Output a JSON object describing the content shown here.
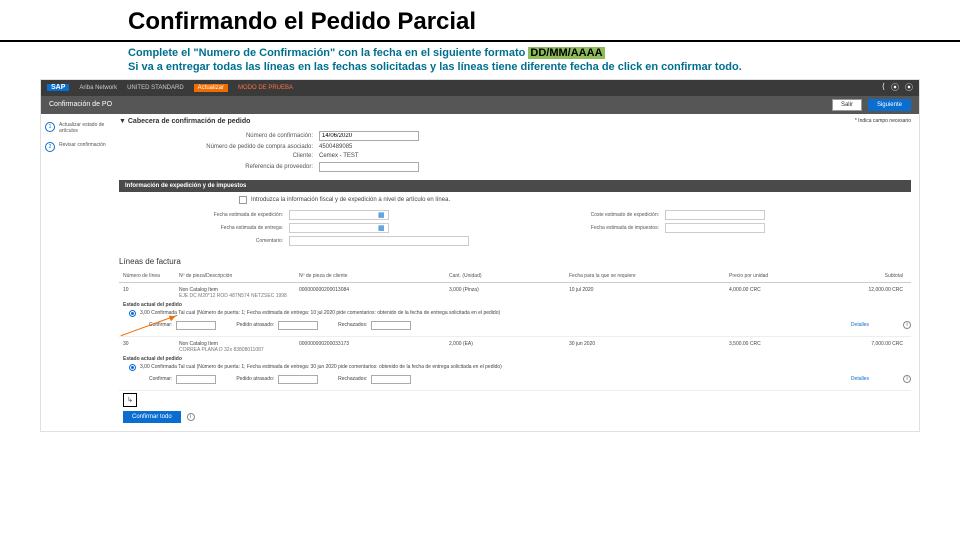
{
  "slide": {
    "title": "Confirmando el Pedido Parcial",
    "instr1_a": "Complete el \"Numero de Confirmación\" con la fecha en el siguiente formato ",
    "instr1_hl": "DD/MM/AAAA",
    "instr2": "Si va a entregar todas las líneas en las fechas solicitadas y las líneas tiene diferente fecha de click en confirmar todo."
  },
  "topbar": {
    "sap": "SAP",
    "network": "Ariba Network",
    "supplier": "UNITED STANDARD",
    "actualizar": "Actualizar",
    "modo": "MODO DE PRUEBA"
  },
  "subbar": {
    "title": "Confirmación de PO",
    "salir": "Salir",
    "siguiente": "Siguiente"
  },
  "steps": {
    "s1": "Actualizar estado de artículos",
    "s2": "Revisar confirmación"
  },
  "header": {
    "panel": "Cabecera de confirmación de pedido",
    "req": "* Indica campo necesario",
    "f1": "Número de confirmación:",
    "f1v": "14/06/2020",
    "f2": "Número de pedido de compra asociado:",
    "f2v": "4500489085",
    "f3": "Cliente:",
    "f3v": "Cemex - TEST",
    "f4": "Referencia de proveedor:"
  },
  "ship": {
    "section": "Información de expedición y de impuestos",
    "cbx_label": "Introduzca la información fiscal y de expedición a nivel de artículo en línea.",
    "r1": "Fecha estimada de expedición:",
    "r2": "Fecha estimada de entrega:",
    "r3": "Comentario:",
    "r4": "Coste estimado de expedición:",
    "r5": "Fecha estimada de impuestos:"
  },
  "lines": {
    "head": "Líneas de factura",
    "h1": "Número de línea",
    "h2": "Nº de pieza/Descripción",
    "h3": "Nº de pieza de cliente",
    "h4": "Cant. (Unidad)",
    "h5": "Fecha para la que se requiere",
    "h6": "Precio por unidad",
    "h7": "Subtotal",
    "status_head": "Estado actual del pedido",
    "confirm": "Confirmar:",
    "ordered": "Pedido atrasado:",
    "rejected": "Rechazados:",
    "details": "Detalles",
    "confirm_all": "Confirmar todo"
  },
  "item1": {
    "num": "10",
    "desc": "Non Catalog Item",
    "meta": "EJE DC M20*12 ROD 487N574 NETZSEC 1998",
    "part": "000000000200013084",
    "qty": "3,000 (Pinza)",
    "date": "10 jul 2020",
    "price": "4,000.00 CRC",
    "subtotal": "12,000.00 CRC",
    "status": "3,00 Confirmada Tal cual (Número de puerta: 1; Fecha estimada de entrega: 10 jul 2020 pide comentarios: obtenido de la fecha de entrega solicitada en el pedido)"
  },
  "item2": {
    "num": "30",
    "desc": "Non Catalog Item",
    "meta": "CORREA PLANA D 32x 83808011087",
    "part": "000000000200033173",
    "qty": "2,000 (EA)",
    "date": "30 jun 2020",
    "price": "3,500.00 CRC",
    "subtotal": "7,000.00 CRC",
    "status": "3,00 Confirmada Tal cual (Número de puerta: 1; Fecha estimada de entrega: 30 jun 2020 pide comentarios: obtenido de la fecha de entrega solicitada en el pedido)"
  }
}
